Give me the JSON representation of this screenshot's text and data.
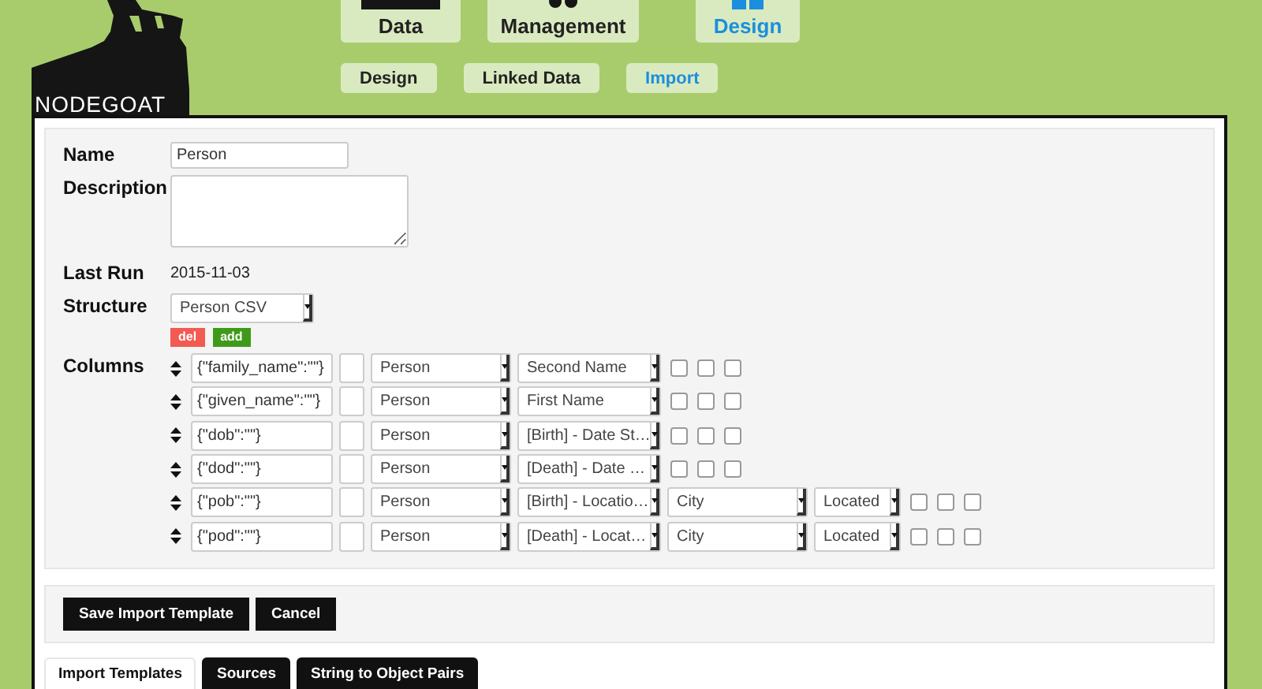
{
  "logo": {
    "text": "NODEGOAT"
  },
  "main_nav": [
    {
      "label": "Data",
      "kind": "data",
      "selected": false
    },
    {
      "label": "Management",
      "kind": "management",
      "selected": false
    },
    {
      "label": "Design",
      "kind": "design",
      "selected": true
    }
  ],
  "sub_nav": [
    {
      "label": "Design",
      "selected": false
    },
    {
      "label": "Linked Data",
      "selected": false
    },
    {
      "label": "Import",
      "selected": true
    }
  ],
  "form": {
    "name": {
      "label": "Name",
      "value": "Person"
    },
    "description": {
      "label": "Description"
    },
    "last_run": {
      "label": "Last Run",
      "value": "2015-11-03"
    },
    "structure": {
      "label": "Structure",
      "value": "Person CSV",
      "buttons": [
        {
          "label": "del",
          "kind": "delete"
        },
        {
          "label": "add",
          "kind": "add"
        }
      ]
    },
    "columns": {
      "label": "Columns",
      "rows": [
        {
          "source": "{\"family_name\":\"\"}",
          "type": "Person",
          "field": "Second Name",
          "options": [
            {
              "checked": false
            },
            {
              "checked": false
            },
            {
              "checked": false
            }
          ]
        },
        {
          "source": "{\"given_name\":\"\"}",
          "type": "Person",
          "field": "First Name",
          "options": [
            {
              "checked": false
            },
            {
              "checked": false
            },
            {
              "checked": false
            }
          ]
        },
        {
          "source": "{\"dob\":\"\"}",
          "type": "Person",
          "field": "[Birth] - Date St…",
          "options": [
            {
              "checked": false
            },
            {
              "checked": false
            },
            {
              "checked": false
            }
          ]
        },
        {
          "source": "{\"dod\":\"\"}",
          "type": "Person",
          "field": "[Death] - Date …",
          "options": [
            {
              "checked": false
            },
            {
              "checked": false
            },
            {
              "checked": false
            }
          ]
        },
        {
          "source": "{\"pob\":\"\"}",
          "type": "Person",
          "field": "[Birth] - Locatio…",
          "reference_type": "City",
          "relation": "Located",
          "options": [
            {
              "checked": false
            },
            {
              "checked": false
            },
            {
              "checked": false
            }
          ]
        },
        {
          "source": "{\"pod\":\"\"}",
          "type": "Person",
          "field": "[Death] - Locat…",
          "reference_type": "City",
          "relation": "Located",
          "options": [
            {
              "checked": false
            },
            {
              "checked": false
            },
            {
              "checked": false
            }
          ]
        }
      ]
    }
  },
  "actions": [
    {
      "label": "Save Import Template"
    },
    {
      "label": "Cancel"
    }
  ],
  "tabs": [
    {
      "label": "Import Templates",
      "selected": true
    },
    {
      "label": "Sources",
      "selected": false
    },
    {
      "label": "String to Object Pairs",
      "selected": false
    }
  ]
}
